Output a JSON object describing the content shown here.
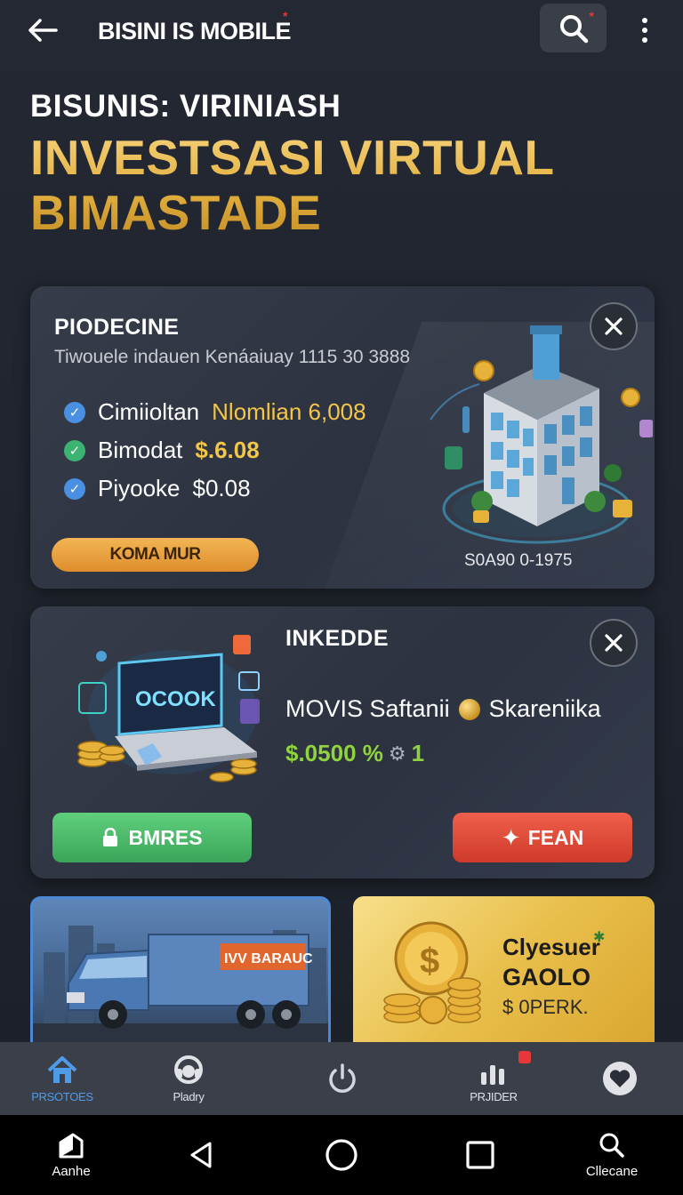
{
  "topbar": {
    "title": "BISINI IS MOBILE",
    "title_star": "*",
    "search_star": "*"
  },
  "hero": {
    "subtitle": "BISUNIS: VIRINIASH",
    "title_line1": "INVESTSASI VIRTUAL",
    "title_line2": "BIMASTADE"
  },
  "card1": {
    "title": "PIODECINE",
    "description": "Tiwouele indauen Kenáaiuay 1115 30 3888",
    "features": [
      {
        "label": "Cimiioltan",
        "value": "Nlomlian 6,008",
        "check_color": "#4a90e2"
      },
      {
        "label": "Bimodat",
        "value": "$.6.08",
        "check_color": "#3cb371"
      },
      {
        "label": "Piyooke",
        "value": "$0.08",
        "check_color": "#4a90e2"
      }
    ],
    "button_label": "KOMA MUR",
    "code": "S0A90 0-1975"
  },
  "card2": {
    "title": "INKEDDE",
    "line_a": "MOVIS Saftanii",
    "line_b": "Skareniika",
    "price": "$.0500 %",
    "price_suffix": "1",
    "laptop_text": "OCOOK",
    "btn_left": "BMRES",
    "btn_right": "FEAN"
  },
  "tiles": {
    "truck_text": "IVV BARAUC",
    "gold_line1": "Clyesuer",
    "gold_line2": "GAOLO",
    "gold_line3": "$ 0PERK."
  },
  "bottom_nav": [
    {
      "label": "PRSOTOES",
      "icon": "home-icon",
      "active": true
    },
    {
      "label": "Pladry",
      "icon": "headset-icon"
    },
    {
      "label": "",
      "icon": "power-icon"
    },
    {
      "label": "PRJIDER",
      "icon": "chart-icon"
    },
    {
      "label": "",
      "icon": "heart-icon"
    }
  ],
  "system_nav": {
    "left_label": "Aanhe",
    "right_label": "Cllecane"
  },
  "colors": {
    "accent_gold": "#f3c64a",
    "accent_blue": "#4f9be8",
    "green": "#3aa55a",
    "red": "#cf3a2a"
  }
}
